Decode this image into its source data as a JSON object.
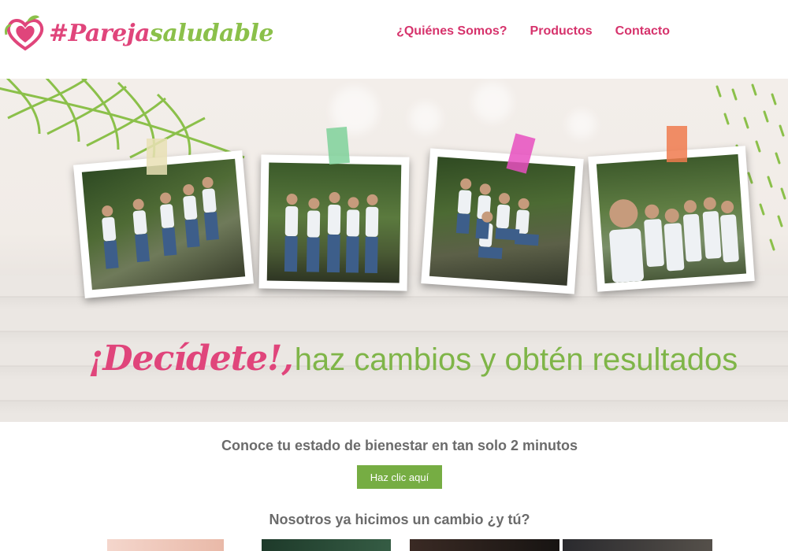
{
  "brand": {
    "hash": "#",
    "word1": "Pareja",
    "word2": "saludable"
  },
  "nav": {
    "items": [
      {
        "label": "¿Quiénes Somos?"
      },
      {
        "label": "Productos"
      },
      {
        "label": "Contacto"
      }
    ]
  },
  "hero": {
    "tagline_highlight": "¡Decídete!,",
    "tagline_rest": "haz cambios y obtén resultados",
    "tape_colors": [
      "#e9e1b5",
      "#7fd19a",
      "#e74fc0",
      "#f07a4e"
    ]
  },
  "quiz": {
    "text": "Conoce tu estado de bienestar en tan solo 2 minutos",
    "button_label": "Haz clic aquí"
  },
  "testimonials": {
    "heading": "Nosotros ya hicimos un cambio ¿y tú?"
  },
  "colors": {
    "brand_pink": "#e0457b",
    "brand_green": "#8bc04a",
    "button_green": "#76ad43",
    "text_gray": "#6b6b6b"
  }
}
